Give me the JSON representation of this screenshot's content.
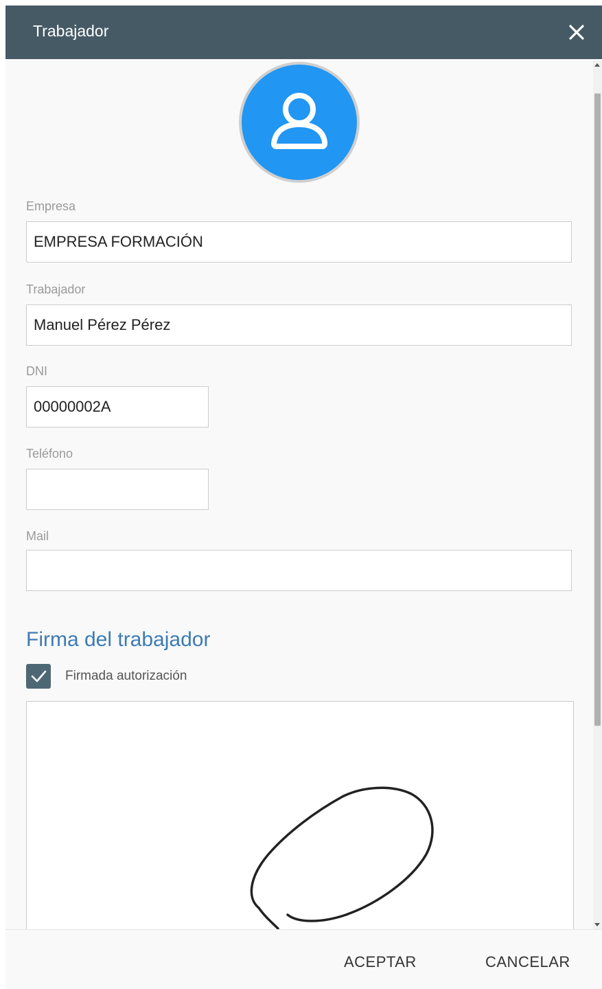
{
  "dialog": {
    "title": "Trabajador",
    "close_icon": "close-icon"
  },
  "avatar": {
    "icon": "user-icon",
    "color": "#2196f3"
  },
  "fields": {
    "empresa": {
      "label": "Empresa",
      "value": "EMPRESA FORMACIÓN"
    },
    "trabajador": {
      "label": "Trabajador",
      "value": "Manuel Pérez Pérez"
    },
    "dni": {
      "label": "DNI",
      "value": "00000002A"
    },
    "telefono": {
      "label": "Teléfono",
      "value": ""
    },
    "mail": {
      "label": "Mail",
      "value": ""
    }
  },
  "signature_section": {
    "title": "Firma del trabajador",
    "checkbox_label": "Firmada autorización",
    "checkbox_checked": true
  },
  "footer": {
    "accept_label": "ACEPTAR",
    "cancel_label": "CANCELAR"
  },
  "colors": {
    "header_bg": "#465a66",
    "accent": "#3d7bb4",
    "avatar": "#2196f3"
  }
}
